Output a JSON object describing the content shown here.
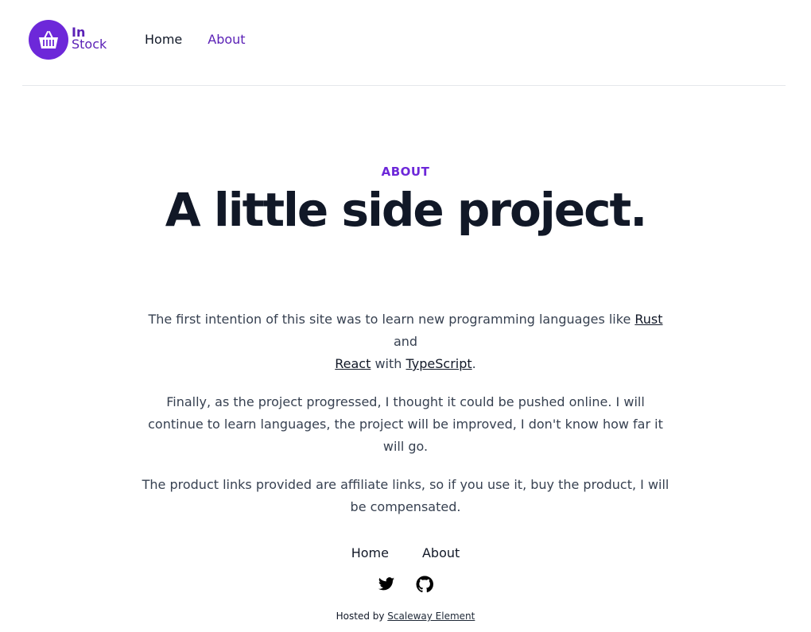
{
  "brand": {
    "line1": "In",
    "line2": "Stock",
    "icon": "basket-icon",
    "color": "#6d28d9"
  },
  "nav": {
    "home": "Home",
    "about": "About"
  },
  "hero": {
    "eyebrow": "ABOUT",
    "title": "A little side project."
  },
  "content": {
    "p1_before": "The first intention of this site was to learn new programming languages like ",
    "rust": "Rust",
    "p1_and": " and",
    "react": "React",
    "p1_with": " with ",
    "typescript": "TypeScript",
    "p1_end": ".",
    "p2": "Finally, as the project progressed, I thought it could be pushed online. I will continue to learn languages, the project will be improved, I don't know how far it will go.",
    "p3": "The product links provided are affiliate links, so if you use it, buy the product, I will be compensated."
  },
  "footer": {
    "home": "Home",
    "about": "About",
    "icons": [
      "twitter-icon",
      "github-icon"
    ],
    "hosted_prefix": "Hosted by ",
    "hosted_link": "Scaleway Element"
  }
}
